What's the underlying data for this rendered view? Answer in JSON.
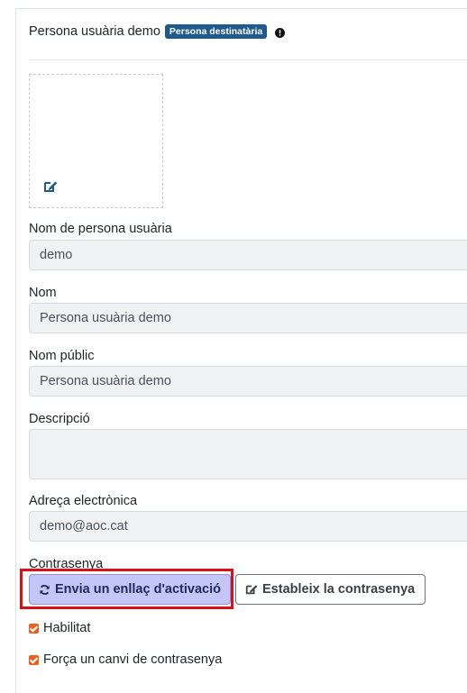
{
  "header": {
    "user_name": "Persona usuària demo",
    "badge": "Persona destinatària",
    "badge_color": "#1e5a8e"
  },
  "avatar": {
    "edit_icon": "edit-icon"
  },
  "fields": {
    "username": {
      "label": "Nom de persona usuària",
      "value": "demo"
    },
    "name": {
      "label": "Nom",
      "value": "Persona usuària demo"
    },
    "public_name": {
      "label": "Nom públic",
      "value": "Persona usuària demo"
    },
    "description": {
      "label": "Descripció",
      "value": ""
    },
    "email": {
      "label": "Adreça electrònica",
      "value": "demo@aoc.cat"
    },
    "password": {
      "label": "Contrasenya"
    }
  },
  "buttons": {
    "send_activation": {
      "label": "Envia un enllaç d'activació",
      "icon": "refresh-icon"
    },
    "set_password": {
      "label": "Estableix la contrasenya",
      "icon": "edit-icon"
    }
  },
  "checkboxes": {
    "enabled": {
      "label": "Habilitat",
      "checked": true
    },
    "force_change": {
      "label": "Força un canvi de contrasenya",
      "checked": true
    }
  },
  "colors": {
    "accent": "#e8601f",
    "highlight": "#d9101a",
    "primary_light": "#c4c5f8"
  }
}
